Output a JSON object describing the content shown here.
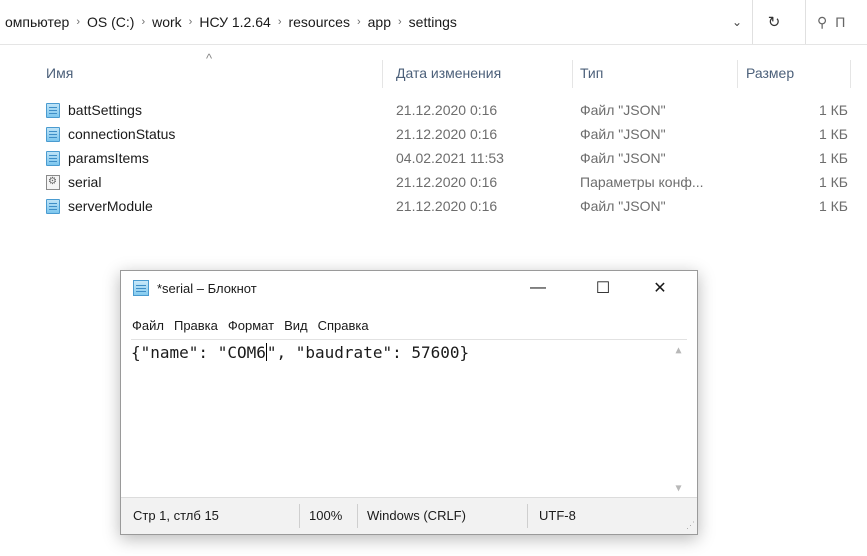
{
  "address_bar": {
    "crumbs": [
      "омпьютер",
      "OS (C:)",
      "work",
      "НСУ 1.2.64",
      "resources",
      "app",
      "settings"
    ],
    "separator": "›",
    "dropdown_icon": "chevron-down-icon",
    "refresh_icon": "refresh-icon",
    "search_partial": "П"
  },
  "columns": {
    "name": "Имя",
    "date": "Дата изменения",
    "type": "Тип",
    "size": "Размер"
  },
  "files": [
    {
      "name": "battSettings",
      "date": "21.12.2020 0:16",
      "type": "Файл \"JSON\"",
      "size": "1 КБ",
      "icon": "json-file-icon"
    },
    {
      "name": "connectionStatus",
      "date": "21.12.2020 0:16",
      "type": "Файл \"JSON\"",
      "size": "1 КБ",
      "icon": "json-file-icon"
    },
    {
      "name": "paramsItems",
      "date": "04.02.2021 11:53",
      "type": "Файл \"JSON\"",
      "size": "1 КБ",
      "icon": "json-file-icon"
    },
    {
      "name": "serial",
      "date": "21.12.2020 0:16",
      "type": "Параметры конф...",
      "size": "1 КБ",
      "icon": "config-file-icon"
    },
    {
      "name": "serverModule",
      "date": "21.12.2020 0:16",
      "type": "Файл \"JSON\"",
      "size": "1 КБ",
      "icon": "json-file-icon"
    }
  ],
  "notepad": {
    "title": "*serial – Блокнот",
    "menu": [
      "Файл",
      "Правка",
      "Формат",
      "Вид",
      "Справка"
    ],
    "content_before_caret": "{\"name\": \"COM6",
    "content_after_caret": "\", \"baudrate\": 57600}",
    "status": {
      "position": "Стр 1, стлб 15",
      "zoom": "100%",
      "line_endings": "Windows (CRLF)",
      "encoding": "UTF-8"
    }
  }
}
